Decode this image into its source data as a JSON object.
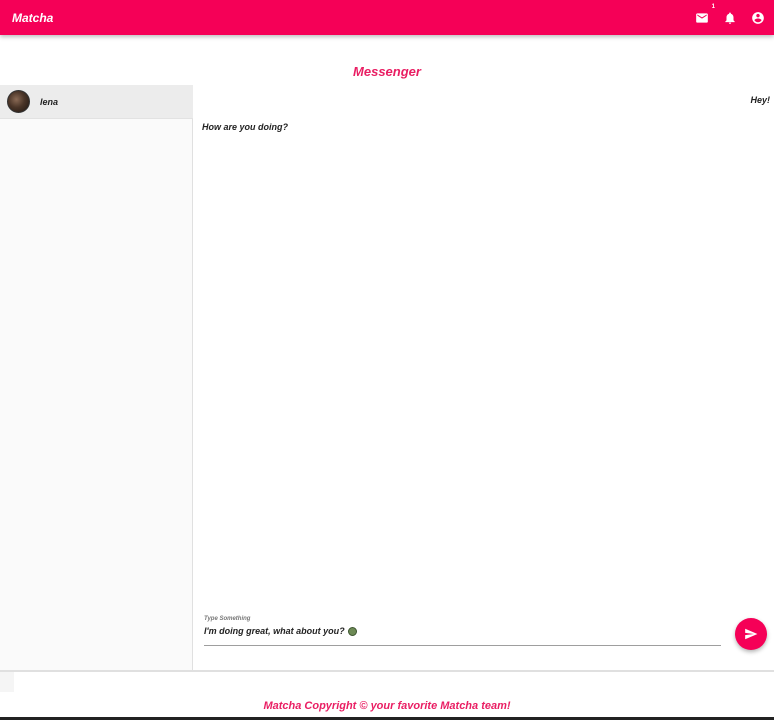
{
  "app": {
    "brand": "Matcha"
  },
  "header": {
    "icons": [
      "mail-icon",
      "bell-icon",
      "account-circle-icon"
    ],
    "mail_badge": "1"
  },
  "page": {
    "title": "Messenger"
  },
  "sidebar": {
    "conversations": [
      {
        "name": "lena",
        "avatar": "avatar-photo"
      }
    ]
  },
  "chat": {
    "messages": [
      {
        "from": "me",
        "text": "Hey!"
      },
      {
        "from": "them",
        "text": "How are you doing?"
      }
    ],
    "input": {
      "label": "Type Something",
      "value": "I'm doing great, what about you?",
      "emoji": "alien-emoji"
    },
    "send_icon": "send-icon"
  },
  "footer": {
    "text": "Matcha Copyright © your favorite Matcha team!"
  },
  "colors": {
    "primary": "#f50057",
    "accent_text": "#e91e63"
  }
}
